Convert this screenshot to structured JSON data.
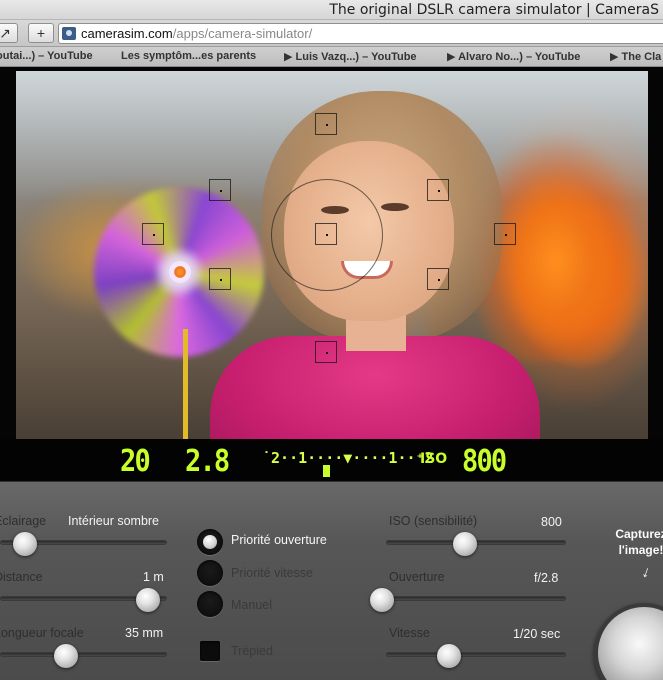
{
  "browser": {
    "window_title": "The original DSLR camera simulator | CameraS",
    "url_host": "camerasim.com",
    "url_path": "/apps/camera-simulator/",
    "new_tab_label": "+",
    "share_label": "↗",
    "bookmarks": [
      "outai...) – YouTube",
      "Les symptôm...es parents",
      "▶ Luis Vazq...) – YouTube",
      "▶ Alvaro No...) – YouTube",
      "▶ The Cla"
    ]
  },
  "viewfinder": {
    "shutter": "20",
    "aperture": "2.8",
    "meter": "˙2··1····▼····1··⁺2",
    "iso_label": "ISO",
    "iso": "800"
  },
  "controls": {
    "lighting": {
      "label": "Éclairage",
      "value": "Intérieur sombre",
      "level": 0.05
    },
    "distance": {
      "label": "Distance",
      "value": "1 m",
      "level": 0.95
    },
    "focal_length": {
      "label": "Longueur focale",
      "value": "35 mm",
      "level": 0.35
    },
    "iso": {
      "label": "ISO (sensibilité)",
      "value": "800",
      "level": 0.48
    },
    "aperture": {
      "label": "Ouverture",
      "value": "f/2.8",
      "level": 0.0
    },
    "shutter": {
      "label": "Vitesse",
      "value": "1/20 sec",
      "level": 0.35
    },
    "modes": [
      {
        "label": "Priorité ouverture",
        "selected": true
      },
      {
        "label": "Priorité vitesse",
        "selected": false
      },
      {
        "label": "Manuel",
        "selected": false
      }
    ],
    "tripod_label": "Trépied",
    "capture_label": "Capturez l'image!"
  }
}
